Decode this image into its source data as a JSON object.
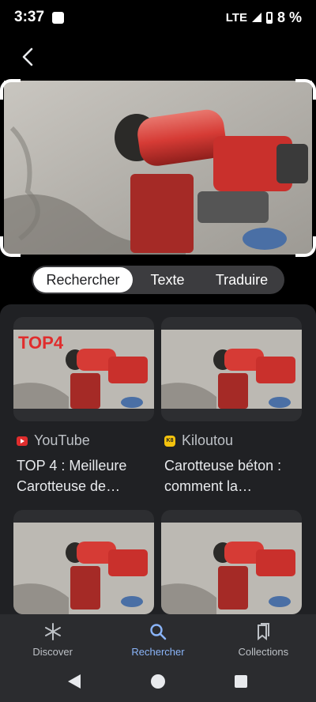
{
  "status": {
    "time": "3:37",
    "network": "LTE",
    "battery": "8 %"
  },
  "tabs": [
    {
      "label": "Rechercher",
      "active": true
    },
    {
      "label": "Texte",
      "active": false
    },
    {
      "label": "Traduire",
      "active": false
    }
  ],
  "results": [
    {
      "source": "YouTube",
      "source_icon": "youtube-icon",
      "title_line1": "TOP 4 : Meilleure",
      "title_line2": "Carotteuse de…",
      "badge": "TOP4"
    },
    {
      "source": "Kiloutou",
      "source_icon": "kiloutou-icon",
      "source_icon_text": "K8",
      "title_line1": "Carotteuse béton :",
      "title_line2": "comment la…"
    },
    {
      "source": "",
      "title_line1": "",
      "title_line2": ""
    },
    {
      "source": "",
      "title_line1": "",
      "title_line2": ""
    }
  ],
  "bottom_nav": [
    {
      "label": "Discover",
      "icon": "asterisk-icon",
      "active": false
    },
    {
      "label": "Rechercher",
      "icon": "search-icon",
      "active": true
    },
    {
      "label": "Collections",
      "icon": "bookmarks-icon",
      "active": false
    }
  ],
  "colors": {
    "accent": "#8ab4f8",
    "surface": "#202124",
    "nav": "#2b2c2f",
    "drill_red": "#d63b35"
  }
}
